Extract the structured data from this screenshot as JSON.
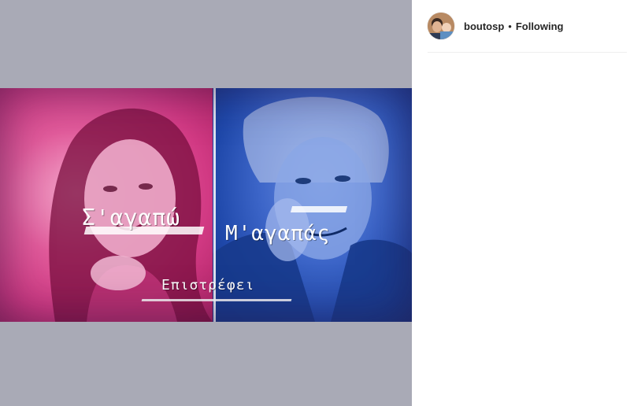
{
  "post": {
    "author": {
      "username": "boutosp",
      "separator": "•",
      "follow_status": "Following"
    },
    "media": {
      "type": "video",
      "captions": {
        "left": "Σ'αγαπώ",
        "right": "Μ'αγαπάς",
        "bottom": "Επιστρέφει"
      },
      "colors": {
        "left_tint": "#d23a84",
        "right_tint": "#2a55b8",
        "backdrop": "#a9aab6"
      }
    }
  }
}
